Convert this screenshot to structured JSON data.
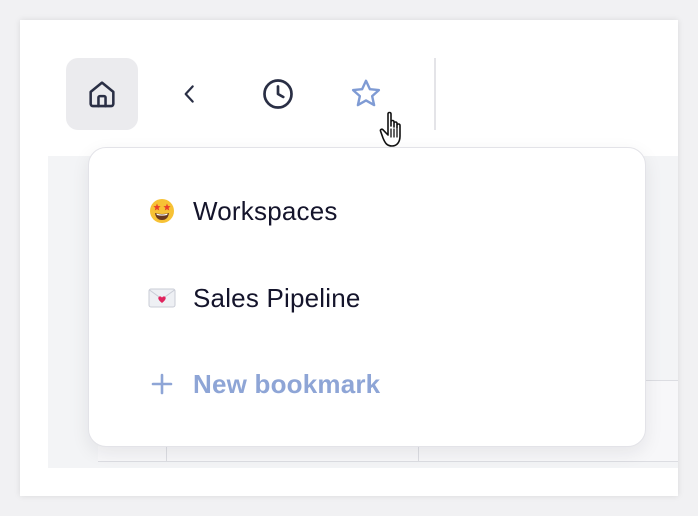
{
  "toolbar": {
    "buttons": [
      {
        "name": "home",
        "icon": "home-icon"
      },
      {
        "name": "back",
        "icon": "chevron-left-icon"
      },
      {
        "name": "history",
        "icon": "clock-icon"
      },
      {
        "name": "bookmarks",
        "icon": "star-icon",
        "state": "hovered"
      }
    ]
  },
  "bookmarks_menu": {
    "items": [
      {
        "icon": "star-struck-emoji-icon",
        "label": "Workspaces"
      },
      {
        "icon": "love-letter-emoji-icon",
        "label": "Sales Pipeline"
      }
    ],
    "new_bookmark": {
      "icon": "plus-icon",
      "label": "New bookmark"
    }
  },
  "colors": {
    "accent": "#8ea5d6",
    "text": "#14142b",
    "icon": "#2a2f45",
    "active_button_bg": "#ebebee"
  }
}
